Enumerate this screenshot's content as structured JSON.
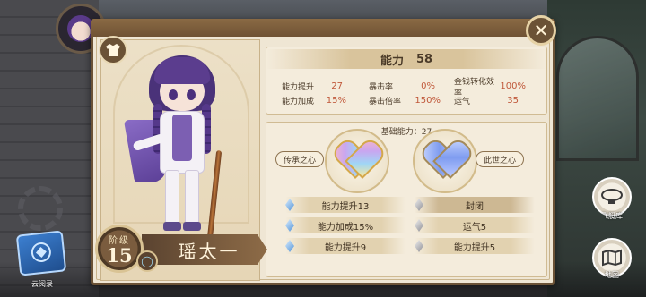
{
  "stats": {
    "title": "能力",
    "total": "58",
    "rows": [
      {
        "label": "能力提升",
        "value": "27"
      },
      {
        "label": "暴击率",
        "value": "0%"
      },
      {
        "label": "金钱转化效率",
        "value": "100%"
      },
      {
        "label": "能力加成",
        "value": "15%"
      },
      {
        "label": "暴击倍率",
        "value": "150%"
      },
      {
        "label": "运气",
        "value": "35"
      }
    ]
  },
  "basic": {
    "title": "基础能力：27",
    "left_heart": "传承之心",
    "right_heart": "此世之心"
  },
  "slots": [
    {
      "label": "能力提升13",
      "gem": "blue"
    },
    {
      "label": "封闭",
      "gem": "grey"
    },
    {
      "label": "能力加成15%",
      "gem": "blue"
    },
    {
      "label": "运气5",
      "gem": "grey"
    },
    {
      "label": "能力提升9",
      "gem": "blue"
    },
    {
      "label": "能力提升5",
      "gem": "grey"
    }
  ],
  "character": {
    "level_label": "阶级",
    "level": "15",
    "name": "瑶太一"
  },
  "side": {
    "airship": "飞艇库",
    "map": "地图",
    "cloud": "云阅录"
  },
  "icons": {
    "close": "close-icon",
    "shirt": "shirt-icon",
    "ring": "ring-icon",
    "airship": "airship-icon",
    "map": "map-icon",
    "scroll": "scroll-icon"
  },
  "colors": {
    "panel": "#efe6d4",
    "frame": "#6b5236",
    "accent_value": "#c0583a"
  }
}
